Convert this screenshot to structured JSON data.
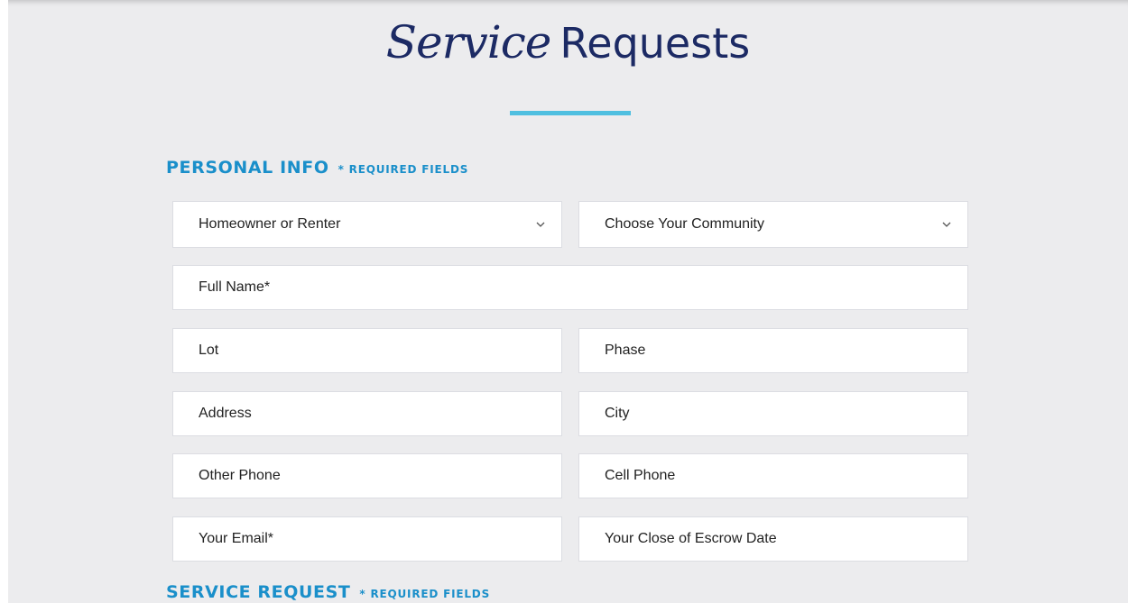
{
  "header": {
    "title_script": "Service",
    "title_plain": "Requests"
  },
  "personal_info": {
    "heading": "PERSONAL INFO",
    "required_note": "* REQUIRED FIELDS",
    "homeowner_select": {
      "selected": "Homeowner or Renter"
    },
    "community_select": {
      "selected": "Choose Your Community"
    },
    "full_name": {
      "value": "",
      "placeholder": "Full Name*"
    },
    "lot": {
      "value": "",
      "placeholder": "Lot"
    },
    "phase": {
      "value": "",
      "placeholder": "Phase"
    },
    "address": {
      "value": "",
      "placeholder": "Address"
    },
    "city": {
      "value": "",
      "placeholder": "City"
    },
    "other_phone": {
      "value": "",
      "placeholder": "Other Phone"
    },
    "cell_phone": {
      "value": "",
      "placeholder": "Cell Phone"
    },
    "email": {
      "value": "",
      "placeholder": "Your Email*"
    },
    "escrow_date": {
      "value": "",
      "placeholder": "Your Close of Escrow Date"
    }
  },
  "service_request": {
    "heading": "SERVICE REQUEST",
    "required_note": "* REQUIRED FIELDS"
  },
  "colors": {
    "background": "#ececee",
    "title": "#1c2a64",
    "accent": "#1a8fca",
    "underline": "#4fbfe0",
    "field_bg": "#ffffff"
  },
  "icons": {
    "select_arrow": "chevron-down-icon"
  }
}
